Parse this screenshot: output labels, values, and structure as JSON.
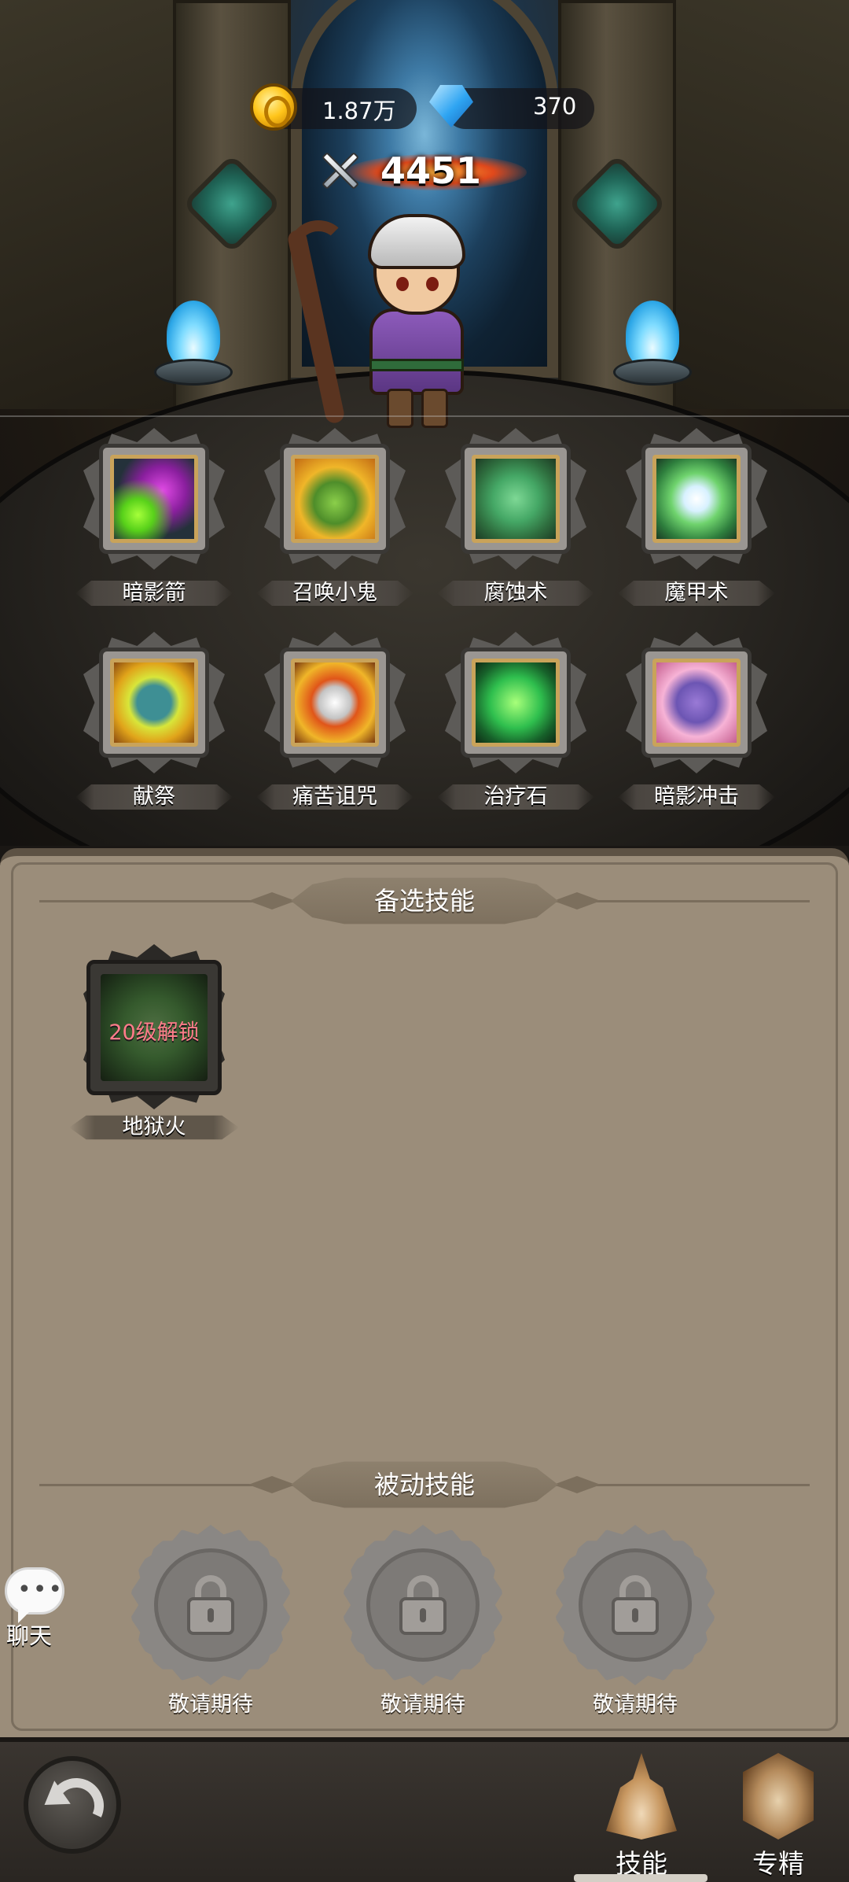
{
  "currency": {
    "gold": "1.87万",
    "gems": "370"
  },
  "power": "4451",
  "equipped_skills": [
    {
      "name": "暗影箭",
      "icon": "shadow-bolt-icon"
    },
    {
      "name": "召唤小鬼",
      "icon": "summon-imp-icon"
    },
    {
      "name": "腐蚀术",
      "icon": "corruption-icon"
    },
    {
      "name": "魔甲术",
      "icon": "demon-armor-icon"
    },
    {
      "name": "献祭",
      "icon": "immolate-icon"
    },
    {
      "name": "痛苦诅咒",
      "icon": "curse-of-agony-icon"
    },
    {
      "name": "治疗石",
      "icon": "healthstone-icon"
    },
    {
      "name": "暗影冲击",
      "icon": "shadow-shock-icon"
    }
  ],
  "alt_skills": {
    "title": "备选技能",
    "items": [
      {
        "name": "地狱火",
        "lock_text": "20级解锁",
        "icon": "hellfire-icon"
      }
    ]
  },
  "passive_skills": {
    "title": "被动技能",
    "items": [
      {
        "label": "敬请期待"
      },
      {
        "label": "敬请期待"
      },
      {
        "label": "敬请期待"
      }
    ]
  },
  "chat": {
    "label": "聊天"
  },
  "bottom_nav": {
    "skills_label": "技能",
    "spec_label": "专精",
    "active": "技能"
  }
}
